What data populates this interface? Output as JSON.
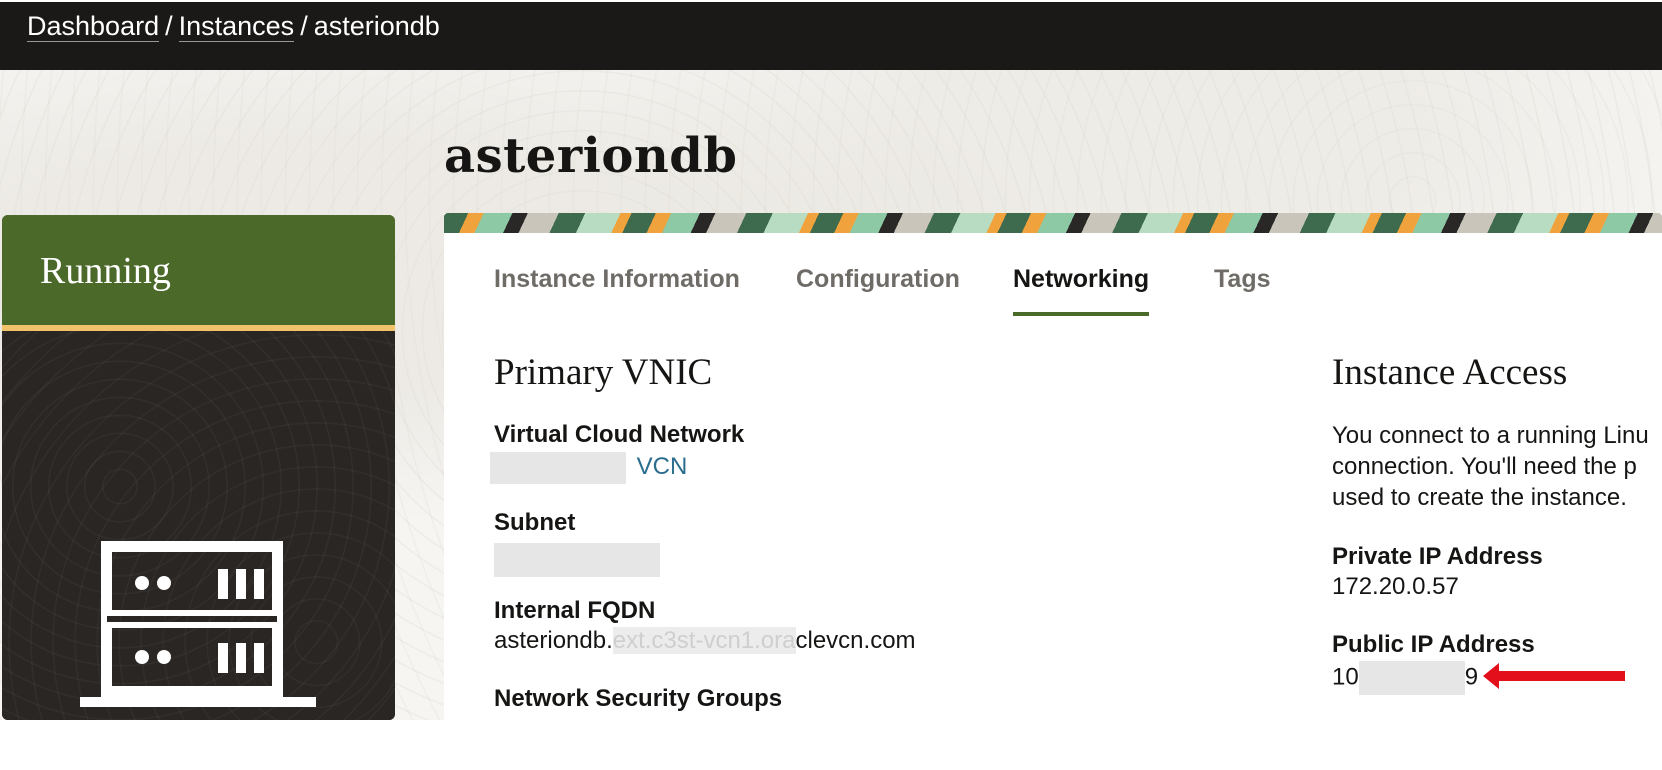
{
  "breadcrumb": {
    "items": [
      "Dashboard",
      "Instances"
    ],
    "separator": "/",
    "current": "asteriondb"
  },
  "instance": {
    "name": "asteriondb",
    "status": "Running"
  },
  "tabs": [
    {
      "label": "Instance Information",
      "active": false
    },
    {
      "label": "Configuration",
      "active": false
    },
    {
      "label": "Networking",
      "active": true
    },
    {
      "label": "Tags",
      "active": false
    }
  ],
  "primary_vnic": {
    "title": "Primary VNIC",
    "vcn_label": "Virtual Cloud Network",
    "vcn_value": "VCN",
    "subnet_label": "Subnet",
    "fqdn_label": "Internal FQDN",
    "fqdn_prefix": "asteriondb.",
    "fqdn_hidden": "ext.c3st-vcn1.ora",
    "fqdn_suffix": "clevcn.com",
    "nsg_label": "Network Security Groups"
  },
  "instance_access": {
    "title": "Instance Access",
    "description_lines": [
      "You connect to a running Linu",
      "connection. You'll need the p",
      "used to create the instance."
    ],
    "private_ip_label": "Private IP Address",
    "private_ip_value": "172.20.0.57",
    "public_ip_label": "Public IP Address",
    "public_ip_start": "10",
    "public_ip_end": "9"
  },
  "colors": {
    "topbar": "#1b1917",
    "status_green": "#4b6a2a",
    "status_accent": "#f0c26a",
    "link": "#2a6d8f",
    "annotation_arrow": "#e3101c"
  },
  "icons": {
    "status": "server-rack-icon",
    "annotation": "red-arrow-icon"
  }
}
